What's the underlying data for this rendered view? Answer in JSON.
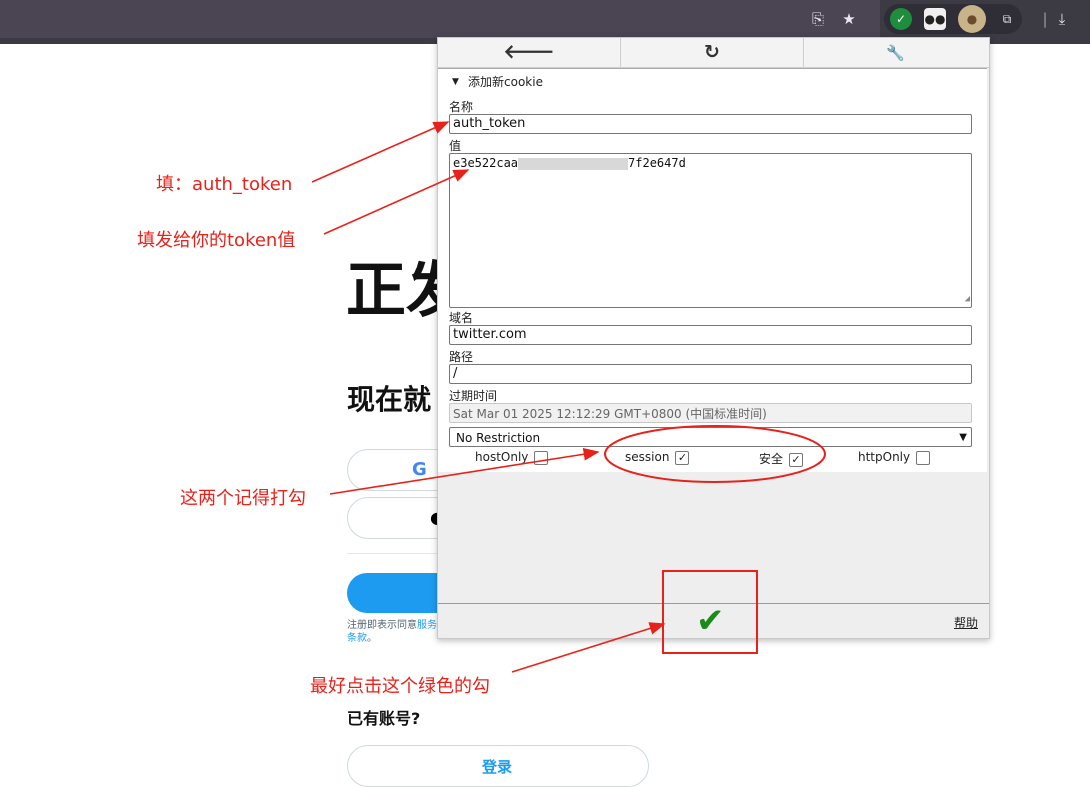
{
  "browser": {
    "icons": [
      "install-icon",
      "star-icon",
      "shield-check-icon",
      "tampermonkey-icon",
      "cookie-icon",
      "puzzle-icon",
      "download-icon"
    ]
  },
  "background_page": {
    "heading_partial": "正发",
    "subheading_partial": "现在就",
    "terms_text_a": "注册即表示同意",
    "terms_link_a": "服务",
    "terms_link_b": "条款",
    "terms_tail": "。",
    "have_account": "已有账号?",
    "login_button": "登录"
  },
  "popup": {
    "toolbar": {
      "back_glyph": "🡐",
      "refresh_glyph": "↻",
      "wrench_glyph": "🔧"
    },
    "section_toggle": "▼",
    "section_title": "添加新cookie",
    "fields": {
      "name_label": "名称",
      "name_value": "auth_token",
      "value_label": "值",
      "value_value_a": "e3e522caa",
      "value_value_b": "7f2e647d",
      "domain_label": "域名",
      "domain_value": "twitter.com",
      "path_label": "路径",
      "path_value": "/",
      "expiry_label": "过期时间",
      "expiry_value": "Sat Mar 01 2025 12:12:29 GMT+0800 (中国标准时间)",
      "samesite_value": "No Restriction"
    },
    "checkboxes": [
      {
        "label": "hostOnly",
        "checked": false
      },
      {
        "label": "session",
        "checked": true
      },
      {
        "label": "安全",
        "checked": true
      },
      {
        "label": "httpOnly",
        "checked": false
      }
    ],
    "check_mark": "✓",
    "help_link": "帮助",
    "confirm_glyph": "✔"
  },
  "annotations": {
    "fill_name": "填：auth_token",
    "fill_value": "填发给你的token值",
    "check_these": "这两个记得打勾",
    "click_green": "最好点击这个绿色的勾"
  },
  "colors": {
    "annotation_red": "#e8221a",
    "twitter_blue": "#1d9bf0",
    "confirm_green": "#1a8a1a"
  }
}
